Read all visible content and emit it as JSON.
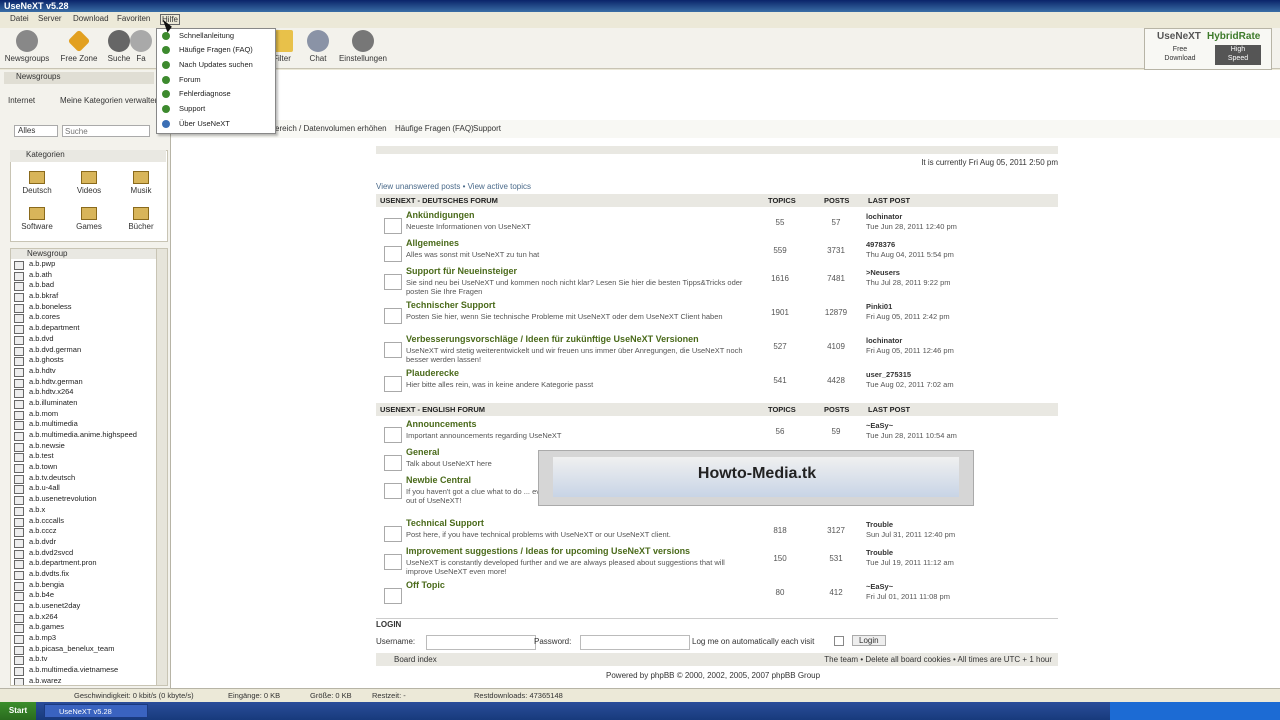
{
  "window": {
    "title": "UseNeXT v5.28"
  },
  "menubar": {
    "items": [
      "Datei",
      "Server",
      "Download",
      "Favoriten",
      "Hilfe"
    ]
  },
  "toolbar": {
    "items": [
      "Newsgroups",
      "Free Zone",
      "Suche",
      "Fa",
      "",
      "Filter",
      "Chat",
      "Einstellungen"
    ]
  },
  "hybridrate": {
    "brand": "UseNeXT",
    "hybrid": "HybridRate",
    "free_label": "Free",
    "free_sub": "Download",
    "high_label": "High",
    "high_sub": "Speed"
  },
  "help_menu": {
    "items": [
      "Schnellanleitung",
      "Häufige Fragen (FAQ)",
      "Nach Updates suchen",
      "Forum",
      "Fehlerdiagnose",
      "Support",
      "Über UseNeXT"
    ]
  },
  "left": {
    "tab": "Newsgroups",
    "filter_label": "Internet",
    "edit_link": "Meine Kategorien verwalten",
    "select_value": "Alles",
    "search_placeholder": "Suche",
    "categories_header": "Kategorien",
    "categories": [
      "Deutsch",
      "Videos",
      "Musik",
      "Software",
      "Games",
      "Bücher"
    ],
    "newsgroup_header": "Newsgroup",
    "newsgroups": [
      "a.b.pwp",
      "a.b.ath",
      "a.b.bad",
      "a.b.bkraf",
      "a.b.boneless",
      "a.b.cores",
      "a.b.department",
      "a.b.dvd",
      "a.b.dvd.german",
      "a.b.ghosts",
      "a.b.hdtv",
      "a.b.hdtv.german",
      "a.b.hdtv.x264",
      "a.b.illuminaten",
      "a.b.mom",
      "a.b.multimedia",
      "a.b.multimedia.anime.highspeed",
      "a.b.newsie",
      "a.b.test",
      "a.b.town",
      "a.b.tv.deutsch",
      "a.b.u-4all",
      "a.b.usenetrevolution",
      "a.b.x",
      "a.b.cccalls",
      "a.b.cccz",
      "a.b.dvdr",
      "a.b.dvd2svcd",
      "a.b.department.pron",
      "a.b.dvdts.fix",
      "a.b.bengia",
      "a.b.b4e",
      "a.b.usenet2day",
      "a.b.x264",
      "a.b.games",
      "a.b.mp3",
      "a.b.picasa_benelux_team",
      "a.b.tv",
      "a.b.multimedia.vietnamese",
      "a.b.warez"
    ]
  },
  "nav": {
    "text": "ereich / Datenvolumen erhöhen",
    "faq": "Häufige Fragen (FAQ)",
    "support": "Support"
  },
  "forum": {
    "current_time": "It is currently Fri Aug 05, 2011 2:50 pm",
    "view_links": "View unanswered posts • View active topics",
    "sections": [
      {
        "name": "USENEXT - DEUTSCHES FORUM",
        "col_topics": "TOPICS",
        "col_posts": "POSTS",
        "col_last": "LAST POST",
        "rows": [
          {
            "title": "Ankündigungen",
            "desc": "Neueste Informationen von UseNeXT",
            "topics": "55",
            "posts": "57",
            "last_by": "lochinator",
            "last_date": "Tue Jun 28, 2011 12:40 pm"
          },
          {
            "title": "Allgemeines",
            "desc": "Alles was sonst mit UseNeXT zu tun hat",
            "topics": "559",
            "posts": "3731",
            "last_by": "4978376",
            "last_date": "Thu Aug 04, 2011 5:54 pm"
          },
          {
            "title": "Support für Neueinsteiger",
            "desc": "Sie sind neu bei UseNeXT und kommen noch nicht klar? Lesen Sie hier die besten Tipps&Tricks oder posten Sie Ihre Fragen",
            "topics": "1616",
            "posts": "7481",
            "last_by": ">Neusers",
            "last_date": "Thu Jul 28, 2011 9:22 pm"
          },
          {
            "title": "Technischer Support",
            "desc": "Posten Sie hier, wenn Sie technische Probleme mit UseNeXT oder dem UseNeXT Client haben",
            "topics": "1901",
            "posts": "12879",
            "last_by": "Pinki01",
            "last_date": "Fri Aug 05, 2011 2:42 pm"
          },
          {
            "title": "Verbesserungsvorschläge / Ideen für zukünftige UseNeXT Versionen",
            "desc": "UseNeXT wird stetig weiterentwickelt und wir freuen uns immer über Anregungen, die UseNeXT noch besser werden lassen!",
            "topics": "527",
            "posts": "4109",
            "last_by": "lochinator",
            "last_date": "Fri Aug 05, 2011 12:46 pm"
          },
          {
            "title": "Plauderecke",
            "desc": "Hier bitte alles rein, was in keine andere Kategorie passt",
            "topics": "541",
            "posts": "4428",
            "last_by": "user_275315",
            "last_date": "Tue Aug 02, 2011 7:02 am"
          }
        ]
      },
      {
        "name": "USENEXT - ENGLISH FORUM",
        "col_topics": "TOPICS",
        "col_posts": "POSTS",
        "col_last": "LAST POST",
        "rows": [
          {
            "title": "Announcements",
            "desc": "Important announcements regarding UseNeXT",
            "topics": "56",
            "posts": "59",
            "last_by": "~EaSy~",
            "last_date": "Tue Jun 28, 2011 10:54 am"
          },
          {
            "title": "General",
            "desc": "Talk about UseNeXT here",
            "topics": "",
            "posts": "",
            "last_by": "",
            "last_date": ""
          },
          {
            "title": "Newbie Central",
            "desc": "If you haven't got a clue what to do ... everyone else knows, this is the ... tips how to get the maximum out of UseNeXT!",
            "topics": "",
            "posts": "",
            "last_by": "",
            "last_date": ""
          },
          {
            "title": "Technical Support",
            "desc": "Post here, if you have technical problems with UseNeXT or our UseNeXT client.",
            "topics": "818",
            "posts": "3127",
            "last_by": "Trouble",
            "last_date": "Sun Jul 31, 2011 12:40 pm"
          },
          {
            "title": "Improvement suggestions / Ideas for upcoming UseNeXT versions",
            "desc": "UseNeXT is constantly developed further and we are always pleased about suggestions that will improve UseNeXT even more!",
            "topics": "150",
            "posts": "531",
            "last_by": "Trouble",
            "last_date": "Tue Jul 19, 2011 11:12 am"
          },
          {
            "title": "Off Topic",
            "desc": "",
            "topics": "80",
            "posts": "412",
            "last_by": "~EaSy~",
            "last_date": "Fri Jul 01, 2011 11:08 pm"
          }
        ]
      }
    ],
    "login_header": "LOGIN",
    "username_label": "Username:",
    "password_label": "Password:",
    "auto_login": "Log me on automatically each visit",
    "login_button": "Login",
    "board_index": "Board index",
    "footer_links": "The team • Delete all board cookies • All times are UTC + 1 hour",
    "powered": "Powered by phpBB © 2000, 2002, 2005, 2007 phpBB Group"
  },
  "overlay": {
    "text": "Howto-Media.tk"
  },
  "status": {
    "speed": "Geschwindigkeit: 0 kbit/s (0 kbyte/s)",
    "incoming": "Eingänge: 0 KB",
    "size": "Größe: 0 KB",
    "rest": "Restzeit: -",
    "remaining": "Restdownloads: 47365148"
  },
  "taskbar": {
    "start": "Start",
    "task": "UseNeXT v5.28"
  }
}
